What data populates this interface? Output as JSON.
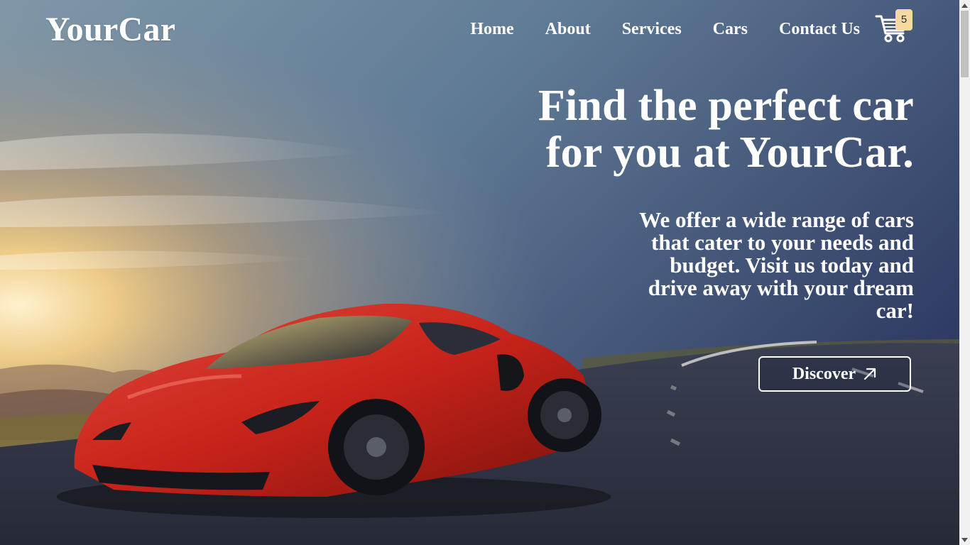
{
  "brand": {
    "logo_text": "YourCar"
  },
  "nav": {
    "items": [
      {
        "label": "Home"
      },
      {
        "label": "About"
      },
      {
        "label": "Services"
      },
      {
        "label": "Cars"
      },
      {
        "label": "Contact Us"
      }
    ]
  },
  "cart": {
    "icon": "shopping-cart-icon",
    "count": "5"
  },
  "hero": {
    "headline_line1": "Find the perfect car",
    "headline_line2": "for you at YourCar.",
    "subtext": "We offer a wide range of cars that cater to your needs and budget. Visit us today and drive away with your dream car!",
    "cta_label": "Discover",
    "cta_icon": "arrow-up-right-icon",
    "background_image": "red-sports-car-on-mountain-road-at-sunset"
  },
  "colors": {
    "text": "#ffffff",
    "badge": "#f5d9a1",
    "car_red": "#c8231a",
    "sky_top": "#3b4a73",
    "sunset_glow": "#f2c070"
  }
}
